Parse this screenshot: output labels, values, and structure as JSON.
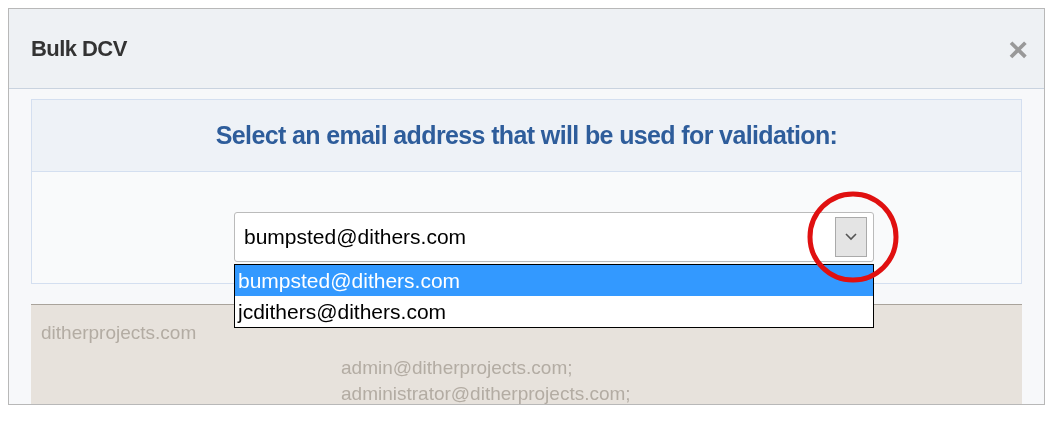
{
  "dialog": {
    "title": "Bulk DCV",
    "close": "×"
  },
  "panel": {
    "heading": "Select an email address that will be used for validation:"
  },
  "select": {
    "value": "bumpsted@dithers.com",
    "expanded": true,
    "options": [
      {
        "label": "bumpsted@dithers.com",
        "selected": true
      },
      {
        "label": "jcdithers@dithers.com",
        "selected": false
      }
    ]
  },
  "background_table": {
    "domain": "ditherprojects.com",
    "emails": [
      "admin@ditherprojects.com;",
      "administrator@ditherprojects.com;"
    ]
  }
}
